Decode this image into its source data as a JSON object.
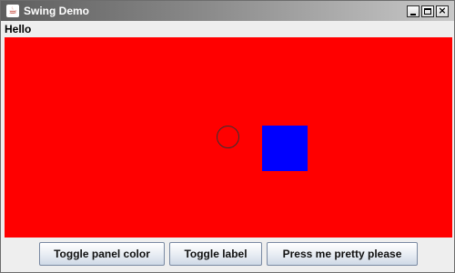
{
  "window": {
    "title": "Swing Demo",
    "app_icon": "java-cup-icon",
    "controls": {
      "minimize": "minimize-icon",
      "maximize": "maximize-icon",
      "close": "close-icon",
      "close_glyph": "×"
    }
  },
  "label": {
    "text": "Hello"
  },
  "panel": {
    "background": "#ff0000",
    "shapes": [
      {
        "kind": "circle",
        "outline_color": "#333333"
      },
      {
        "kind": "square",
        "fill_color": "#0000ff"
      }
    ]
  },
  "buttons": {
    "toggle_color": "Toggle panel color",
    "toggle_label": "Toggle label",
    "press_me": "Press me pretty please"
  }
}
